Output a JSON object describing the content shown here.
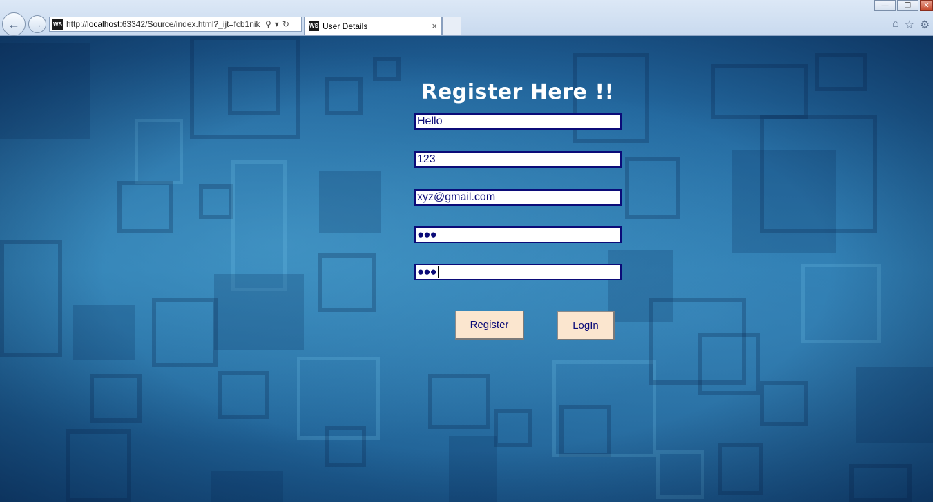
{
  "browser": {
    "url_prefix": "http://",
    "url_host": "localhost",
    "url_rest": ":63342/Source/index.html?_ijt=fcb1nik",
    "tab_title": "User Details",
    "favicon_text": "WS",
    "back_icon": "←",
    "forward_icon": "→",
    "search_icon": "⚲",
    "dropdown_icon": "▾",
    "refresh_icon": "↻",
    "tab_close_icon": "×",
    "home_icon": "⌂",
    "favorites_icon": "☆",
    "settings_icon": "⚙",
    "minimize_icon": "—",
    "restore_icon": "❐",
    "close_icon": "✕"
  },
  "form": {
    "heading": "Register Here !!",
    "fields": [
      {
        "name": "username",
        "value": "Hello"
      },
      {
        "name": "number",
        "value": "123"
      },
      {
        "name": "email",
        "value": "xyz@gmail.com"
      },
      {
        "name": "password",
        "value": "●●●"
      },
      {
        "name": "confirm_password",
        "value": "●●●"
      }
    ],
    "register_label": "Register",
    "login_label": "LogIn"
  },
  "colors": {
    "field_border": "#0b0b78",
    "button_bg": "#fbe6cf",
    "text_accent": "#0b0b78"
  }
}
